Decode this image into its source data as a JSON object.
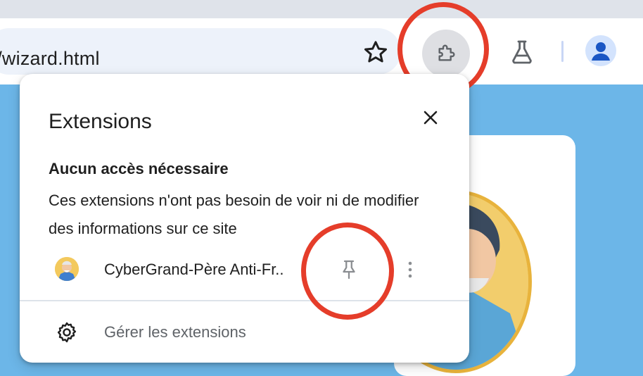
{
  "browser": {
    "url": "a/wizard.html",
    "colors": {
      "omnibox": "#edf2fa",
      "page_bg": "#6cb6e8",
      "annotation": "#e53d2a"
    },
    "icons": [
      "star-icon",
      "puzzle-icon",
      "flask-icon",
      "person-icon"
    ]
  },
  "popup": {
    "title": "Extensions",
    "section_title": "Aucun accès nécessaire",
    "section_description": "Ces extensions n'ont pas besoin de voir ni de modifier des informations sur ce site",
    "extensions": [
      {
        "name": "CyberGrand-Père Anti-Fr..",
        "icon": "grandpa-avatar-icon"
      }
    ],
    "manage_label": "Gérer les extensions",
    "icons": [
      "close-icon",
      "pin-icon",
      "more-vert-icon",
      "gear-icon"
    ]
  }
}
